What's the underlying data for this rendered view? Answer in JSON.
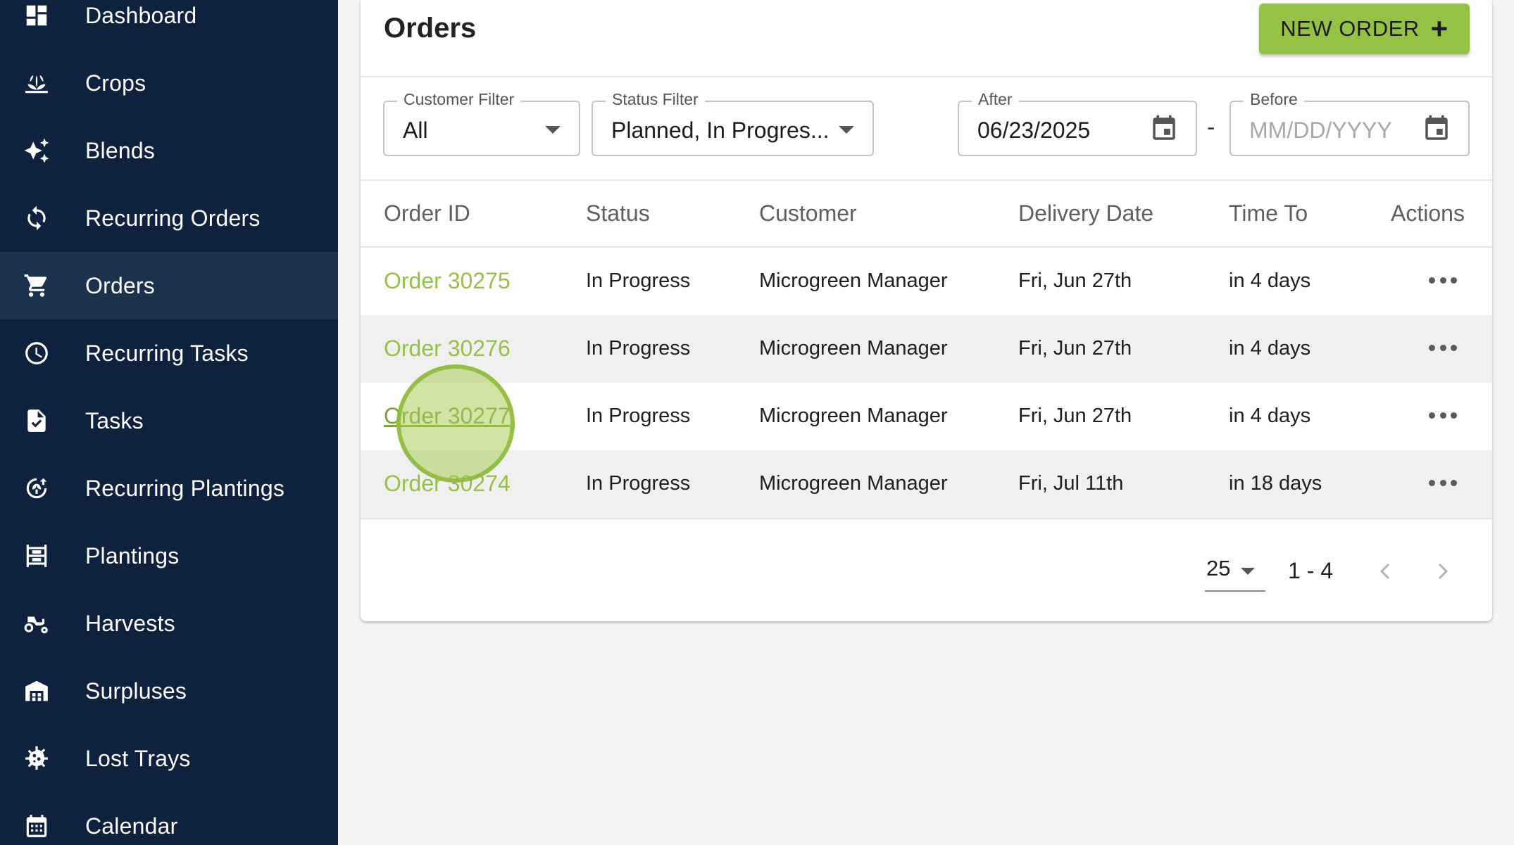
{
  "sidebar": {
    "items": [
      {
        "label": "Dashboard",
        "icon": "dashboard-icon"
      },
      {
        "label": "Crops",
        "icon": "sprout-icon"
      },
      {
        "label": "Blends",
        "icon": "sparkle-icon"
      },
      {
        "label": "Recurring Orders",
        "icon": "refresh-icon"
      },
      {
        "label": "Orders",
        "icon": "cart-icon",
        "active": true
      },
      {
        "label": "Recurring Tasks",
        "icon": "clock-icon"
      },
      {
        "label": "Tasks",
        "icon": "checklist-icon"
      },
      {
        "label": "Recurring Plantings",
        "icon": "sprout-cycle-icon"
      },
      {
        "label": "Plantings",
        "icon": "tray-rack-icon"
      },
      {
        "label": "Harvests",
        "icon": "tractor-icon"
      },
      {
        "label": "Surpluses",
        "icon": "warehouse-icon"
      },
      {
        "label": "Lost Trays",
        "icon": "virus-icon"
      },
      {
        "label": "Calendar",
        "icon": "calendar-icon"
      }
    ]
  },
  "header": {
    "title": "Orders",
    "new_order_label": "NEW ORDER",
    "new_order_plus": "+"
  },
  "filters": {
    "customer": {
      "label": "Customer Filter",
      "value": "All"
    },
    "status": {
      "label": "Status Filter",
      "value": "Planned, In Progres..."
    },
    "after": {
      "label": "After",
      "value": "06/23/2025"
    },
    "before": {
      "label": "Before",
      "placeholder": "MM/DD/YYYY"
    },
    "range_separator": "-"
  },
  "table": {
    "columns": [
      "Order ID",
      "Status",
      "Customer",
      "Delivery Date",
      "Time To",
      "Actions"
    ],
    "rows": [
      {
        "order_id": "Order 30275",
        "status": "In Progress",
        "customer": "Microgreen Manager",
        "delivery_date": "Fri, Jun 27th",
        "time_to": "in 4 days"
      },
      {
        "order_id": "Order 30276",
        "status": "In Progress",
        "customer": "Microgreen Manager",
        "delivery_date": "Fri, Jun 27th",
        "time_to": "in 4 days"
      },
      {
        "order_id": "Order 30277",
        "status": "In Progress",
        "customer": "Microgreen Manager",
        "delivery_date": "Fri, Jun 27th",
        "time_to": "in 4 days"
      },
      {
        "order_id": "Order 30274",
        "status": "In Progress",
        "customer": "Microgreen Manager",
        "delivery_date": "Fri, Jul 11th",
        "time_to": "in 18 days"
      }
    ]
  },
  "pagination": {
    "per_page": "25",
    "range": "1 - 4"
  },
  "colors": {
    "sidebar_bg": "#0e2240",
    "sidebar_active_bg": "#1b324f",
    "accent_green": "#95c245"
  }
}
